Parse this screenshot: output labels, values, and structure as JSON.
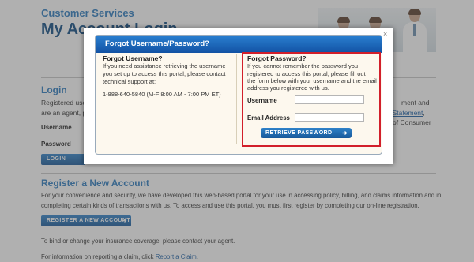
{
  "header": {
    "subtitle": "Customer Services",
    "title": "My Account Login"
  },
  "login": {
    "heading": "Login",
    "intro_line1": "Registered users",
    "intro_line2": "are an agent, ple",
    "right_line1": "ment and",
    "right_line2_link": "licy Statement",
    "right_line2_tail": ",",
    "right_line3": "of Consumer",
    "username_label": "Username",
    "password_label": "Password",
    "login_button": "LOGIN"
  },
  "register": {
    "heading": "Register a New Account",
    "para_line1": "For your convenience and security, we have developed this web-based portal for your use in accessing policy, billing, and claims information and in",
    "para_line2": "completing certain kinds of transactions with us. To access and use this portal, you must first register by completing our on-line registration.",
    "button": "REGISTER A NEW ACCOUNT",
    "coverage_text": "To bind or change your insurance coverage, please contact your agent.",
    "claim_text": "For information on reporting a claim, click ",
    "claim_link": "Report a Claim",
    "claim_tail": "."
  },
  "modal": {
    "title": "Forgot Username/Password?",
    "close": "×",
    "username_col": {
      "title": "Forgot Username?",
      "line1": "If you need assistance retrieving the username",
      "line2": "you set up to access this portal, please contact",
      "line3": "technical support at:",
      "phone": "1-888-640-5840 (M-F 8:00 AM - 7:00 PM ET)"
    },
    "password_col": {
      "title": "Forgot Password?",
      "line1": "If you cannot remember the password you",
      "line2": "registered to access this portal, please fill out",
      "line3": "the form below with your username and the email",
      "line4": "address you registered with us.",
      "username_label": "Username",
      "email_label": "Email Address",
      "username_value": "",
      "email_value": "",
      "button": "RETRIEVE PASSWORD"
    }
  },
  "colors": {
    "accent": "#2a7abf",
    "title": "#0e4b84",
    "button": "#17589a",
    "highlight": "#d21f2b"
  }
}
